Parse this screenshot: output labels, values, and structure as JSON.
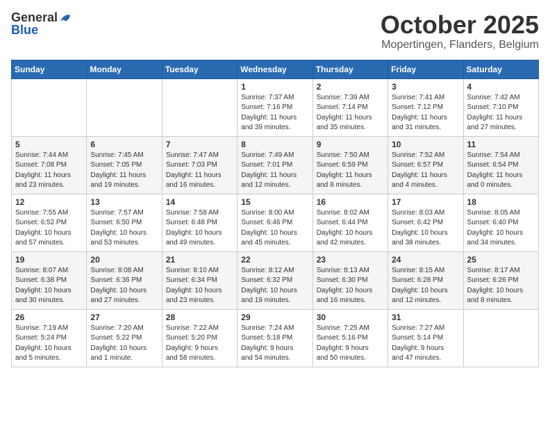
{
  "header": {
    "logo_general": "General",
    "logo_blue": "Blue",
    "month": "October 2025",
    "location": "Mopertingen, Flanders, Belgium"
  },
  "weekdays": [
    "Sunday",
    "Monday",
    "Tuesday",
    "Wednesday",
    "Thursday",
    "Friday",
    "Saturday"
  ],
  "weeks": [
    [
      {
        "day": "",
        "info": ""
      },
      {
        "day": "",
        "info": ""
      },
      {
        "day": "",
        "info": ""
      },
      {
        "day": "1",
        "info": "Sunrise: 7:37 AM\nSunset: 7:16 PM\nDaylight: 11 hours\nand 39 minutes."
      },
      {
        "day": "2",
        "info": "Sunrise: 7:39 AM\nSunset: 7:14 PM\nDaylight: 11 hours\nand 35 minutes."
      },
      {
        "day": "3",
        "info": "Sunrise: 7:41 AM\nSunset: 7:12 PM\nDaylight: 11 hours\nand 31 minutes."
      },
      {
        "day": "4",
        "info": "Sunrise: 7:42 AM\nSunset: 7:10 PM\nDaylight: 11 hours\nand 27 minutes."
      }
    ],
    [
      {
        "day": "5",
        "info": "Sunrise: 7:44 AM\nSunset: 7:08 PM\nDaylight: 11 hours\nand 23 minutes."
      },
      {
        "day": "6",
        "info": "Sunrise: 7:45 AM\nSunset: 7:05 PM\nDaylight: 11 hours\nand 19 minutes."
      },
      {
        "day": "7",
        "info": "Sunrise: 7:47 AM\nSunset: 7:03 PM\nDaylight: 11 hours\nand 16 minutes."
      },
      {
        "day": "8",
        "info": "Sunrise: 7:49 AM\nSunset: 7:01 PM\nDaylight: 11 hours\nand 12 minutes."
      },
      {
        "day": "9",
        "info": "Sunrise: 7:50 AM\nSunset: 6:59 PM\nDaylight: 11 hours\nand 8 minutes."
      },
      {
        "day": "10",
        "info": "Sunrise: 7:52 AM\nSunset: 6:57 PM\nDaylight: 11 hours\nand 4 minutes."
      },
      {
        "day": "11",
        "info": "Sunrise: 7:54 AM\nSunset: 6:54 PM\nDaylight: 11 hours\nand 0 minutes."
      }
    ],
    [
      {
        "day": "12",
        "info": "Sunrise: 7:55 AM\nSunset: 6:52 PM\nDaylight: 10 hours\nand 57 minutes."
      },
      {
        "day": "13",
        "info": "Sunrise: 7:57 AM\nSunset: 6:50 PM\nDaylight: 10 hours\nand 53 minutes."
      },
      {
        "day": "14",
        "info": "Sunrise: 7:58 AM\nSunset: 6:48 PM\nDaylight: 10 hours\nand 49 minutes."
      },
      {
        "day": "15",
        "info": "Sunrise: 8:00 AM\nSunset: 6:46 PM\nDaylight: 10 hours\nand 45 minutes."
      },
      {
        "day": "16",
        "info": "Sunrise: 8:02 AM\nSunset: 6:44 PM\nDaylight: 10 hours\nand 42 minutes."
      },
      {
        "day": "17",
        "info": "Sunrise: 8:03 AM\nSunset: 6:42 PM\nDaylight: 10 hours\nand 38 minutes."
      },
      {
        "day": "18",
        "info": "Sunrise: 8:05 AM\nSunset: 6:40 PM\nDaylight: 10 hours\nand 34 minutes."
      }
    ],
    [
      {
        "day": "19",
        "info": "Sunrise: 8:07 AM\nSunset: 6:38 PM\nDaylight: 10 hours\nand 30 minutes."
      },
      {
        "day": "20",
        "info": "Sunrise: 8:08 AM\nSunset: 6:36 PM\nDaylight: 10 hours\nand 27 minutes."
      },
      {
        "day": "21",
        "info": "Sunrise: 8:10 AM\nSunset: 6:34 PM\nDaylight: 10 hours\nand 23 minutes."
      },
      {
        "day": "22",
        "info": "Sunrise: 8:12 AM\nSunset: 6:32 PM\nDaylight: 10 hours\nand 19 minutes."
      },
      {
        "day": "23",
        "info": "Sunrise: 8:13 AM\nSunset: 6:30 PM\nDaylight: 10 hours\nand 16 minutes."
      },
      {
        "day": "24",
        "info": "Sunrise: 8:15 AM\nSunset: 6:28 PM\nDaylight: 10 hours\nand 12 minutes."
      },
      {
        "day": "25",
        "info": "Sunrise: 8:17 AM\nSunset: 6:26 PM\nDaylight: 10 hours\nand 8 minutes."
      }
    ],
    [
      {
        "day": "26",
        "info": "Sunrise: 7:19 AM\nSunset: 5:24 PM\nDaylight: 10 hours\nand 5 minutes."
      },
      {
        "day": "27",
        "info": "Sunrise: 7:20 AM\nSunset: 5:22 PM\nDaylight: 10 hours\nand 1 minute."
      },
      {
        "day": "28",
        "info": "Sunrise: 7:22 AM\nSunset: 5:20 PM\nDaylight: 9 hours\nand 58 minutes."
      },
      {
        "day": "29",
        "info": "Sunrise: 7:24 AM\nSunset: 5:18 PM\nDaylight: 9 hours\nand 54 minutes."
      },
      {
        "day": "30",
        "info": "Sunrise: 7:25 AM\nSunset: 5:16 PM\nDaylight: 9 hours\nand 50 minutes."
      },
      {
        "day": "31",
        "info": "Sunrise: 7:27 AM\nSunset: 5:14 PM\nDaylight: 9 hours\nand 47 minutes."
      },
      {
        "day": "",
        "info": ""
      }
    ]
  ]
}
